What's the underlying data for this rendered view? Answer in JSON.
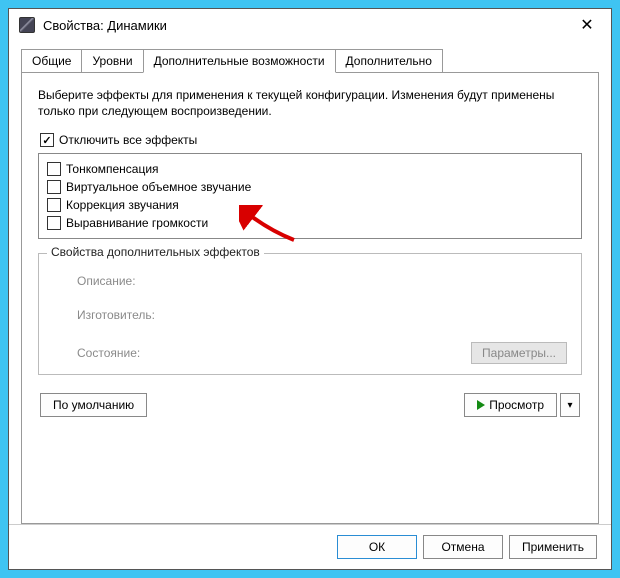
{
  "window": {
    "title": "Свойства: Динамики"
  },
  "tabs": [
    "Общие",
    "Уровни",
    "Дополнительные возможности",
    "Дополнительно"
  ],
  "activeTab": 2,
  "instructions": "Выберите эффекты для применения к текущей конфигурации. Изменения будут применены только при следующем воспроизведении.",
  "disableAll": {
    "label": "Отключить все эффекты",
    "checked": true
  },
  "effects": [
    {
      "label": "Тонкомпенсация",
      "checked": false
    },
    {
      "label": "Виртуальное объемное звучание",
      "checked": false
    },
    {
      "label": "Коррекция звучания",
      "checked": false
    },
    {
      "label": "Выравнивание громкости",
      "checked": false
    }
  ],
  "propsGroup": {
    "legend": "Свойства дополнительных эффектов",
    "descLabel": "Описание:",
    "vendorLabel": "Изготовитель:",
    "statusLabel": "Состояние:",
    "paramsBtn": "Параметры..."
  },
  "buttons": {
    "defaults": "По умолчанию",
    "preview": "Просмотр",
    "ok": "ОК",
    "cancel": "Отмена",
    "apply": "Применить"
  }
}
